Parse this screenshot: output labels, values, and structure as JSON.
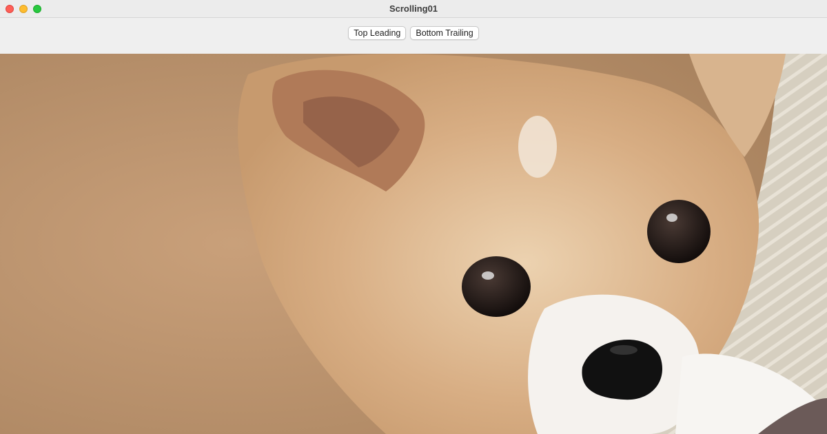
{
  "window": {
    "title": "Scrolling01",
    "controls": [
      "close-icon",
      "minimize-icon",
      "maximize-icon"
    ]
  },
  "toolbar": {
    "top_leading_label": "Top Leading",
    "bottom_trailing_label": "Bottom Trailing"
  },
  "content": {
    "image_subject": "dog-photo",
    "colors": {
      "fur": "#c99a6e",
      "fur_light": "#e6c9a6",
      "carpet": "#d9d2c3",
      "eye": "#1b1412",
      "nose": "#111111",
      "muzzle": "#f4f1ee"
    }
  }
}
